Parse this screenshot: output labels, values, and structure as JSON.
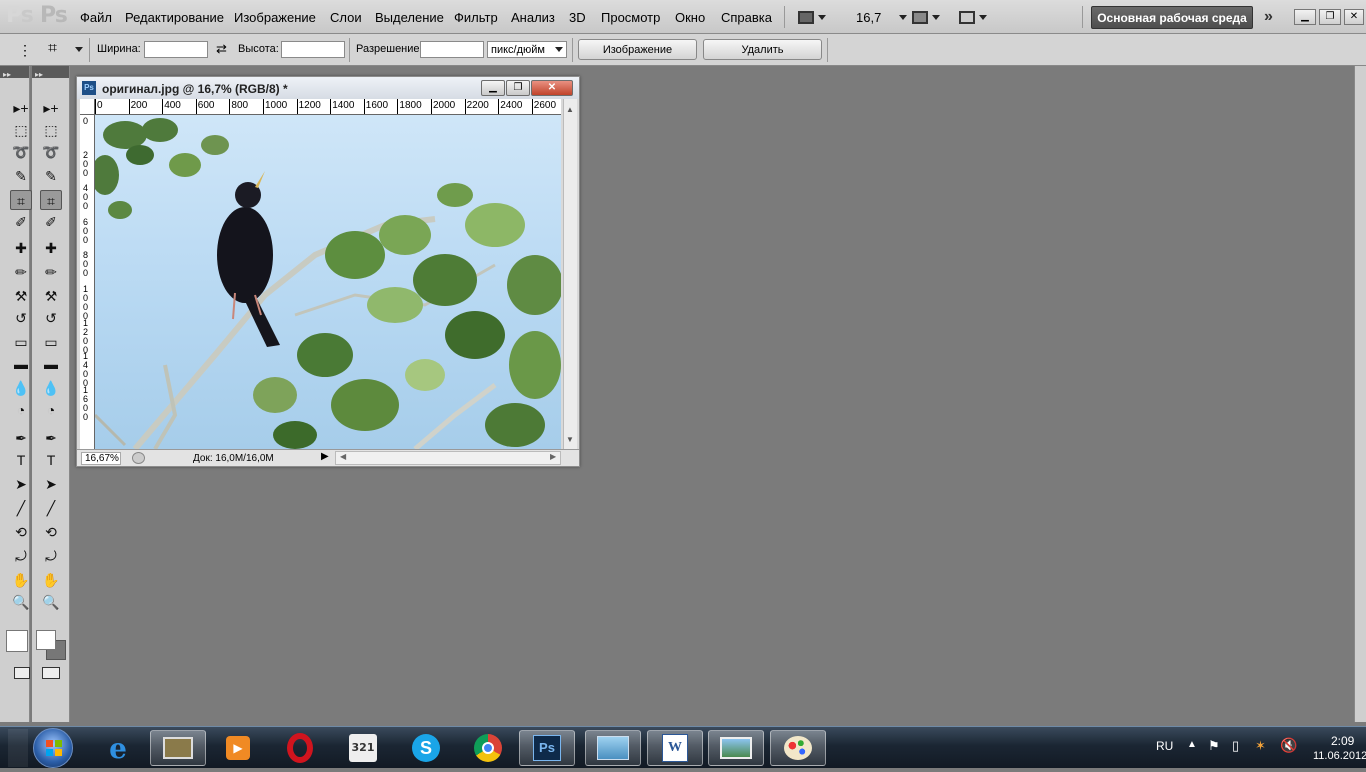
{
  "menubar": {
    "logo": "Ps",
    "items": [
      "Файл",
      "Редактирование",
      "Изображение",
      "Слои",
      "Выделение",
      "Фильтр",
      "Анализ",
      "3D",
      "Просмотр",
      "Окно",
      "Справка"
    ],
    "zoom_value": "16,7",
    "workspace_label": "Основная рабочая среда",
    "expand_icon": "double-chevron-right-icon"
  },
  "options": {
    "width_label": "Ширина:",
    "height_label": "Высота:",
    "resolution_label": "Разрешение:",
    "unit_value": "пикс/дюйм",
    "front_image_btn": "Изображение",
    "clear_btn": "Удалить"
  },
  "document": {
    "title": "оригинал.jpg @ 16,7% (RGB/8) *",
    "ruler_top_ticks": [
      "0",
      "200",
      "400",
      "600",
      "800",
      "1000",
      "1200",
      "1400",
      "1600",
      "1800",
      "2000",
      "2200",
      "2400",
      "2600"
    ],
    "ruler_left_ticks": [
      "0",
      "2\n0\n0",
      "4\n0\n0",
      "6\n0\n0",
      "8\n0\n0",
      "1\n0\n0\n0",
      "1\n2\n0\n0",
      "1\n4\n0\n0",
      "1\n6\n0\n0"
    ],
    "zoom": "16,67%",
    "doc_size": "Док: 16,0M/16,0M"
  },
  "tools": [
    "move-tool",
    "marquee-tool",
    "lasso-tool",
    "quick-selection-tool",
    "crop-tool",
    "eyedropper-tool",
    "spot-healing-tool",
    "brush-tool",
    "clone-stamp-tool",
    "history-brush-tool",
    "eraser-tool",
    "gradient-tool",
    "blur-tool",
    "dodge-tool",
    "pen-tool",
    "type-tool",
    "path-selection-tool",
    "line-tool",
    "3d-rotate-tool",
    "3d-orbit-tool",
    "hand-tool",
    "zoom-tool"
  ],
  "taskbar": {
    "apps": [
      "start",
      "internet-explorer",
      "file-manager",
      "media-player",
      "opera",
      "media-player-classic",
      "skype",
      "chrome",
      "photoshop",
      "explorer",
      "word",
      "photo-viewer",
      "paint"
    ],
    "language": "RU",
    "time": "2:09",
    "date": "11.06.2012"
  }
}
